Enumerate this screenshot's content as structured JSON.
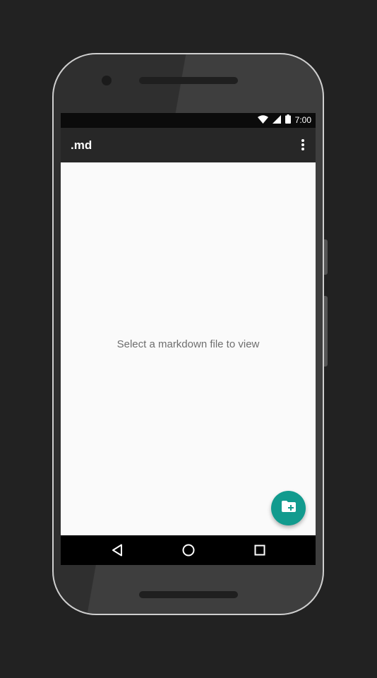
{
  "status_bar": {
    "time": "7:00",
    "icons": [
      "wifi-icon",
      "cell-signal-icon",
      "battery-icon"
    ]
  },
  "app_bar": {
    "title": ".md",
    "overflow_icon": "more-vert-icon"
  },
  "content": {
    "empty_message": "Select a markdown file to view"
  },
  "fab": {
    "icon": "folder-add-icon",
    "color": "#129b8e"
  },
  "nav_bar": {
    "buttons": [
      "back-icon",
      "home-icon",
      "recents-icon"
    ]
  },
  "colors": {
    "app_bar": "#272727",
    "status_bar": "#0b0b0b",
    "background": "#fafafa",
    "accent": "#129b8e",
    "device_frame": "#3a3a3a",
    "page_background": "#222222"
  }
}
